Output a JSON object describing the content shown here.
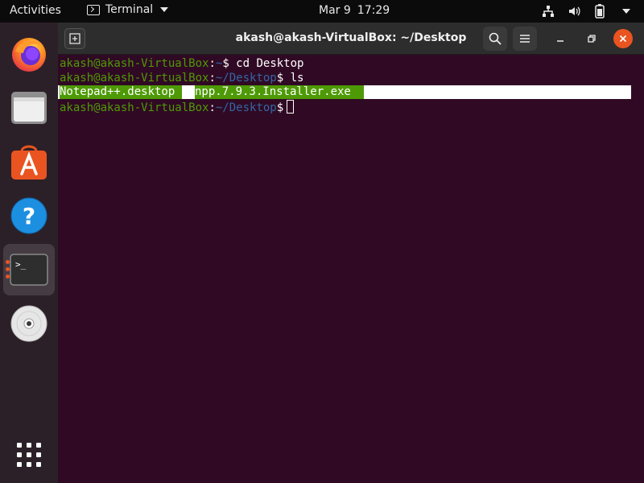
{
  "topbar": {
    "activities": "Activities",
    "app_name": "Terminal",
    "date": "Mar 9",
    "time": "17:29"
  },
  "dock": {
    "items": [
      {
        "name": "firefox",
        "running": false
      },
      {
        "name": "files",
        "running": false
      },
      {
        "name": "ubuntu-software",
        "running": false
      },
      {
        "name": "help",
        "running": false
      },
      {
        "name": "terminal",
        "running": true,
        "active": true
      },
      {
        "name": "dvd-drive",
        "running": false
      },
      {
        "name": "show-applications",
        "running": false
      }
    ]
  },
  "window": {
    "title": "akash@akash-VirtualBox: ~/Desktop"
  },
  "terminal": {
    "user_host": "akash@akash-VirtualBox",
    "lines": [
      {
        "path": "~",
        "command": "cd Desktop"
      },
      {
        "path": "~/Desktop",
        "command": "ls"
      },
      {
        "path": "~/Desktop",
        "command": ""
      }
    ],
    "ls_output": [
      "Notepad++.desktop",
      "npp.7.9.3.Installer.exe"
    ]
  },
  "colors": {
    "terminal_bg": "#300a24",
    "prompt_green": "#4e9a06",
    "path_blue": "#3465a4",
    "accent_orange": "#e95420"
  }
}
